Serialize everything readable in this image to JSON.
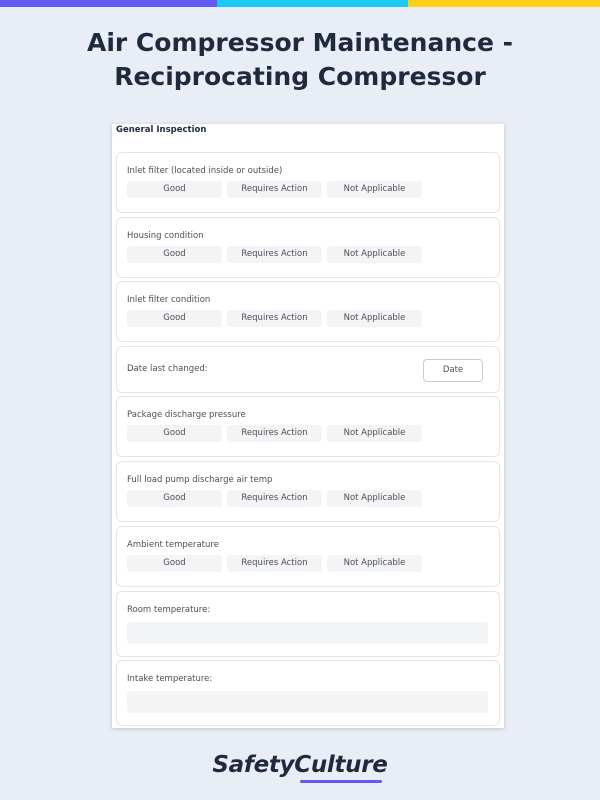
{
  "colors": {
    "bar_purple": "#6559f5",
    "bar_cyan": "#1ec8f5",
    "bar_yellow": "#fcd214",
    "background": "#e9edf5",
    "title": "#1f2b3d"
  },
  "page": {
    "title": "Air Compressor Maintenance - Reciprocating Compressor"
  },
  "form": {
    "section_title": "General Inspection",
    "rows": [
      {
        "label": "Inlet filter (located inside or outside)",
        "options": [
          "Good",
          "Requires Action",
          "Not Applicable"
        ]
      },
      {
        "label": "Housing condition",
        "options": [
          "Good",
          "Requires Action",
          "Not Applicable"
        ]
      },
      {
        "label": "Inlet filter condition",
        "options": [
          "Good",
          "Requires Action",
          "Not Applicable"
        ]
      },
      {
        "label": "Date last changed:",
        "button": "Date"
      },
      {
        "label": "Package discharge pressure",
        "options": [
          "Good",
          "Requires Action",
          "Not Applicable"
        ]
      },
      {
        "label": "Full load pump discharge air temp",
        "options": [
          "Good",
          "Requires Action",
          "Not Applicable"
        ]
      },
      {
        "label": "Ambient temperature",
        "options": [
          "Good",
          "Requires Action",
          "Not Applicable"
        ]
      },
      {
        "label": "Room temperature:",
        "input_value": ""
      },
      {
        "label": "Intake temperature:",
        "input_value": ""
      }
    ]
  },
  "brand": {
    "name": "SafetyCulture"
  }
}
